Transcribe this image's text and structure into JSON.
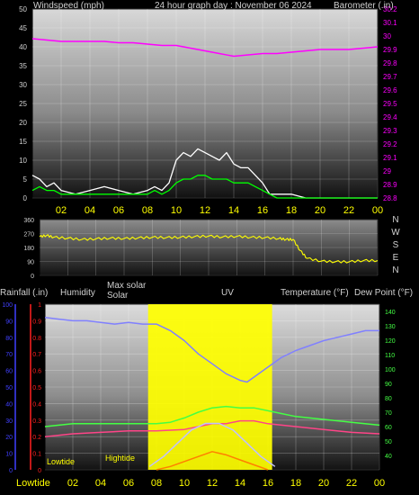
{
  "header": {
    "wind_title": "Windspeed (mph)",
    "graph_title": "24 hour graph day : November 06 2024",
    "baro_title": "Barometer (.in)"
  },
  "colors": {
    "wind": "#ffffff",
    "gust": "#00ff00",
    "baro": "#ff00ff",
    "direction": "#ffff00",
    "time_labels": "#ffff00",
    "humidity": "#8080ff",
    "temperature": "#ff4488",
    "dewpoint": "#44ff44",
    "solar": "#ffff00",
    "uv": "#ff8000",
    "rain_axis": "#4040ff",
    "humidity_axis": "#ff2020"
  },
  "chart_data": [
    {
      "type": "line",
      "name": "wind-barometer",
      "x_ticks": [
        "02",
        "04",
        "06",
        "08",
        "10",
        "12",
        "14",
        "16",
        "18",
        "20",
        "22",
        "00"
      ],
      "xlim_hours": [
        0,
        24
      ],
      "y_left": {
        "label": "Windspeed (mph)",
        "ylim": [
          0,
          50
        ],
        "ticks": [
          0,
          5,
          10,
          15,
          20,
          25,
          30,
          35,
          40,
          45,
          50
        ]
      },
      "y_right": {
        "label": "Barometer (.in)",
        "ylim": [
          28.8,
          30.2
        ],
        "ticks": [
          "28.8",
          "28.9",
          "29",
          "29.1",
          "29.2",
          "29.3",
          "29.4",
          "29.5",
          "29.6",
          "29.7",
          "29.8",
          "29.9",
          "30",
          "30.1",
          "30.2"
        ]
      },
      "series": [
        {
          "name": "Windspeed",
          "axis": "left",
          "x": [
            0,
            0.5,
            1,
            1.5,
            2,
            3,
            4,
            5,
            6,
            7,
            8,
            8.5,
            9,
            9.5,
            10,
            10.5,
            11,
            11.5,
            12,
            12.5,
            13,
            13.5,
            14,
            14.5,
            15,
            15.5,
            16,
            16.5,
            17,
            18,
            19,
            20,
            21,
            22,
            23,
            24
          ],
          "y": [
            6,
            5,
            3,
            4,
            2,
            1,
            2,
            3,
            2,
            1,
            2,
            3,
            2,
            4,
            10,
            12,
            11,
            13,
            12,
            11,
            10,
            12,
            9,
            8,
            8,
            6,
            4,
            1,
            1,
            1,
            0,
            0,
            0,
            0,
            0,
            0
          ]
        },
        {
          "name": "Gust",
          "axis": "left",
          "x": [
            0,
            0.5,
            1,
            1.5,
            2,
            3,
            4,
            5,
            6,
            7,
            8,
            8.5,
            9,
            9.5,
            10,
            10.5,
            11,
            11.5,
            12,
            12.5,
            13,
            13.5,
            14,
            14.5,
            15,
            15.5,
            16,
            16.5,
            17,
            18,
            19,
            20,
            21,
            22,
            23,
            24
          ],
          "y": [
            2,
            3,
            2,
            2,
            1,
            1,
            1,
            1,
            1,
            1,
            1,
            2,
            1,
            2,
            4,
            5,
            5,
            6,
            6,
            5,
            5,
            5,
            4,
            4,
            4,
            3,
            2,
            1,
            0,
            0,
            0,
            0,
            0,
            0,
            0,
            0
          ]
        },
        {
          "name": "Barometer",
          "axis": "right",
          "x": [
            0,
            1,
            2,
            3,
            4,
            5,
            6,
            7,
            8,
            9,
            10,
            11,
            12,
            13,
            14,
            15,
            16,
            17,
            18,
            19,
            20,
            21,
            22,
            23,
            24
          ],
          "y": [
            29.98,
            29.97,
            29.96,
            29.96,
            29.96,
            29.96,
            29.95,
            29.95,
            29.94,
            29.93,
            29.93,
            29.91,
            29.89,
            29.87,
            29.85,
            29.86,
            29.87,
            29.87,
            29.88,
            29.89,
            29.9,
            29.9,
            29.9,
            29.91,
            29.92
          ]
        }
      ]
    },
    {
      "type": "line",
      "name": "wind-direction",
      "ylim": [
        0,
        360
      ],
      "y_ticks": [
        0,
        90,
        180,
        270,
        360
      ],
      "y_tick_labels": [
        "0",
        "90",
        "180",
        "270",
        "360"
      ],
      "direction_labels": [
        "N",
        "W",
        "S",
        "E",
        "N"
      ],
      "series": [
        {
          "name": "Wind direction",
          "x": [
            0,
            0.5,
            1,
            2,
            3,
            4,
            5,
            6,
            7,
            8,
            9,
            10,
            11,
            12,
            13,
            14,
            15,
            16,
            17,
            17.5,
            18,
            18.5,
            19,
            20,
            21,
            22,
            23,
            24
          ],
          "y": [
            250,
            258,
            246,
            240,
            232,
            236,
            240,
            238,
            242,
            246,
            244,
            246,
            250,
            254,
            248,
            252,
            246,
            244,
            238,
            232,
            232,
            160,
            110,
            92,
            88,
            88,
            96,
            96
          ]
        }
      ]
    },
    {
      "type": "line",
      "name": "temperature-humidity-solar",
      "headers": [
        "Rainfall (.in)",
        "Humidity",
        "Max solar",
        "Solar",
        "UV",
        "Temperature (°F)",
        "Dew Point (°F)"
      ],
      "rain_axis": {
        "ylim": [
          0,
          1
        ],
        "ticks": [
          "0",
          "0.1",
          "0.2",
          "0.3",
          "0.4",
          "0.5",
          "0.6",
          "0.7",
          "0.8",
          "0.9",
          "1"
        ]
      },
      "humidity_axis": {
        "ylim": [
          0,
          100
        ],
        "ticks": [
          "0",
          "10",
          "20",
          "30",
          "40",
          "50",
          "60",
          "70",
          "80",
          "90",
          "100"
        ]
      },
      "temp_axis": {
        "ylim": [
          30,
          145
        ],
        "ticks": [
          "40",
          "50",
          "60",
          "70",
          "80",
          "90",
          "100",
          "110",
          "120",
          "130",
          "140"
        ]
      },
      "tide_labels": {
        "low1": "Lowtide",
        "high": "Hightide",
        "low2": "Lowtide"
      },
      "series": [
        {
          "name": "Humidity",
          "axis": "humidity",
          "x": [
            0,
            1,
            2,
            3,
            4,
            5,
            6,
            7,
            8,
            9,
            10,
            11,
            12,
            13,
            14,
            14.5,
            15,
            16,
            17,
            18,
            19,
            20,
            21,
            22,
            23,
            24
          ],
          "y": [
            92,
            91,
            90,
            90,
            89,
            88,
            89,
            88,
            88,
            84,
            78,
            70,
            64,
            58,
            54,
            53,
            56,
            62,
            68,
            72,
            75,
            78,
            80,
            82,
            84,
            84
          ]
        },
        {
          "name": "Temperature",
          "axis": "temp",
          "x": [
            0,
            2,
            4,
            6,
            8,
            10,
            11,
            12,
            13,
            14,
            15,
            16,
            18,
            20,
            22,
            24
          ],
          "y": [
            53,
            55,
            56,
            57,
            57,
            58,
            60,
            62,
            62,
            64,
            64,
            62,
            60,
            58,
            56,
            55
          ]
        },
        {
          "name": "Dew Point",
          "axis": "temp",
          "x": [
            0,
            1,
            2,
            4,
            6,
            8,
            9,
            10,
            11,
            12,
            13,
            14,
            15,
            16,
            17,
            18,
            20,
            22,
            24
          ],
          "y": [
            60,
            61,
            62,
            62,
            62,
            62,
            63,
            66,
            70,
            73,
            74,
            73,
            73,
            71,
            69,
            67,
            65,
            63,
            61
          ]
        },
        {
          "name": "Max solar",
          "axis": "humidity",
          "x": [
            7.5,
            8.5,
            9.5,
            10.5,
            11.5,
            12.5,
            13.5,
            14.5,
            15.5,
            16.5
          ],
          "y": [
            2,
            8,
            16,
            24,
            28,
            28,
            24,
            16,
            8,
            2
          ]
        },
        {
          "name": "UV",
          "axis": "humidity",
          "x": [
            8,
            9,
            10,
            11,
            12,
            12.5,
            13,
            14,
            15,
            16
          ],
          "y": [
            0,
            2,
            5,
            8,
            11,
            10,
            9,
            6,
            3,
            0
          ]
        }
      ]
    }
  ]
}
